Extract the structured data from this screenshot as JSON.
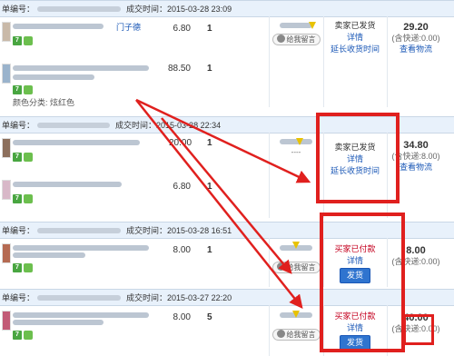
{
  "orders": [
    {
      "id_label": "单编号：",
      "time_label": "成交时间：",
      "time": "2015-03-28 23:09",
      "items": [
        {
          "price": "6.80",
          "qty": "1",
          "title_tail": "门子德"
        },
        {
          "price": "88.50",
          "qty": "1",
          "color_label": "颜色分类: 炫红色"
        }
      ],
      "status": "卖家已发货",
      "detail": "详情",
      "extend": "延长收货时间",
      "total": "29.20",
      "shipping": "(含快递:0.00)",
      "logistics": "查看物流",
      "msg": "给我留言"
    },
    {
      "id_label": "单编号：",
      "time_label": "成交时间：",
      "time": "2015-03-28 22:34",
      "items": [
        {
          "price": "20.00",
          "qty": "1"
        },
        {
          "price": "6.80",
          "qty": "1"
        }
      ],
      "status": "卖家已发货",
      "detail": "详情",
      "extend": "延长收货时间",
      "total": "34.80",
      "shipping": "(含快递:8.00)",
      "logistics": "查看物流",
      "seller_sub": "----"
    },
    {
      "id_label": "单编号：",
      "time_label": "成交时间：",
      "time": "2015-03-28 16:51",
      "items": [
        {
          "price": "8.00",
          "qty": "1"
        }
      ],
      "status": "买家已付款",
      "detail": "详情",
      "action": "发货",
      "total": "8.00",
      "shipping": "(含快递:0.00)",
      "msg": "给我留言"
    },
    {
      "id_label": "单编号：",
      "time_label": "成交时间：",
      "time": "2015-03-27 22:20",
      "items": [
        {
          "price": "8.00",
          "qty": "5"
        }
      ],
      "status": "买家已付款",
      "detail": "详情",
      "action": "发货",
      "total": "40.00",
      "shipping": "(含快递:0.00)",
      "msg": "给我留言"
    }
  ],
  "colors": {
    "header_bg": "#e8f1fb",
    "highlight": "#e0201e",
    "link": "#1a57b6",
    "button": "#2f74cf"
  }
}
